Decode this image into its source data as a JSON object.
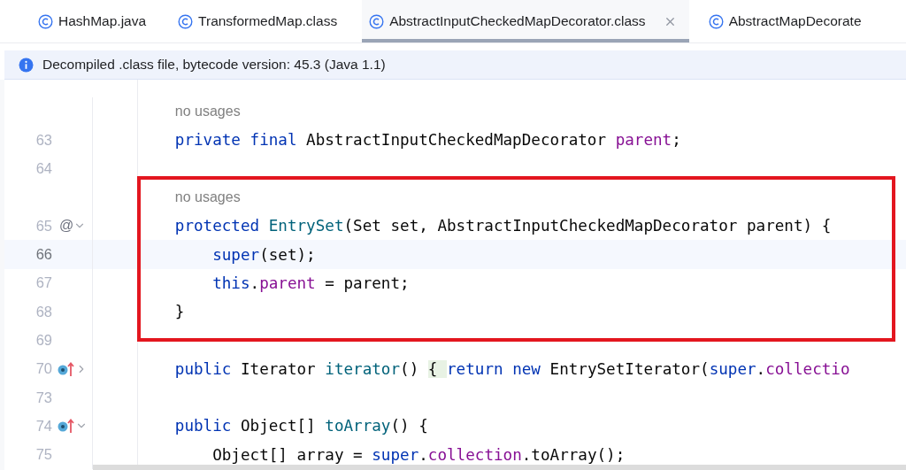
{
  "tabs": [
    {
      "label": "HashMap.java",
      "selected": false
    },
    {
      "label": "TransformedMap.class",
      "selected": false
    },
    {
      "label": "AbstractInputCheckedMapDecorator.class",
      "selected": true
    },
    {
      "label": "AbstractMapDecorate",
      "selected": false
    }
  ],
  "banner": {
    "text": "Decompiled .class file, bytecode version: 45.3 (Java 1.1)"
  },
  "editor": {
    "lines_before": [
      {
        "kind": "hint",
        "text": "no usages"
      },
      {
        "kind": "code",
        "number": "63",
        "current": false,
        "tokens": [
          {
            "kind": "keyword",
            "text": "private final"
          },
          {
            "kind": "plain",
            "text": " AbstractInputCheckedMapDecorator "
          },
          {
            "kind": "field",
            "text": "parent"
          },
          {
            "kind": "plain",
            "text": ";"
          }
        ]
      },
      {
        "kind": "code",
        "number": "64",
        "current": false
      }
    ],
    "boxed_lines": [
      {
        "kind": "hint",
        "text": "no usages"
      },
      {
        "kind": "code",
        "number": "65",
        "gutter_mark": "@",
        "expanded": true,
        "current": false,
        "tokens": [
          {
            "kind": "keyword",
            "text": "protected "
          },
          {
            "kind": "method",
            "text": "EntrySet"
          },
          {
            "kind": "plain",
            "text": "(Set set, AbstractInputCheckedMapDecorator parent) {"
          }
        ],
        "children": [
          {
            "kind": "code",
            "number": "66",
            "current": true,
            "tokens": [
              {
                "kind": "keyword",
                "text": "super"
              },
              {
                "kind": "plain",
                "text": "(set);"
              }
            ]
          },
          {
            "kind": "code",
            "number": "67",
            "current": false,
            "tokens": [
              {
                "kind": "keyword",
                "text": "this"
              },
              {
                "kind": "plain",
                "text": "."
              },
              {
                "kind": "field",
                "text": "parent"
              },
              {
                "kind": "plain",
                "text": " = parent;"
              }
            ]
          }
        ]
      },
      {
        "kind": "code",
        "number": "68",
        "current": false,
        "tokens": [
          {
            "kind": "plain",
            "text": "}"
          }
        ]
      }
    ],
    "lines_after": [
      {
        "kind": "code",
        "number": "69",
        "current": false
      },
      {
        "kind": "code",
        "number": "70",
        "override": true,
        "expanded": false,
        "current": false,
        "tokens": [
          {
            "kind": "keyword",
            "text": "public"
          },
          {
            "kind": "plain",
            "text": " Iterator "
          },
          {
            "kind": "method",
            "text": "iterator"
          },
          {
            "kind": "plain",
            "text": "() "
          },
          {
            "kind": "brace",
            "text": "{ "
          },
          {
            "kind": "keyword",
            "text": "return new"
          },
          {
            "kind": "plain",
            "text": " EntrySetIterator("
          },
          {
            "kind": "keyword",
            "text": "super"
          },
          {
            "kind": "plain",
            "text": "."
          },
          {
            "kind": "field",
            "text": "collectio"
          }
        ]
      },
      {
        "kind": "code",
        "number": "73",
        "current": false
      },
      {
        "kind": "code",
        "number": "74",
        "override": true,
        "expanded": true,
        "current": false,
        "tokens": [
          {
            "kind": "keyword",
            "text": "public"
          },
          {
            "kind": "plain",
            "text": " Object[] "
          },
          {
            "kind": "method",
            "text": "toArray"
          },
          {
            "kind": "plain",
            "text": "() {"
          }
        ],
        "children": [
          {
            "kind": "code",
            "number": "75",
            "current": false,
            "tokens": [
              {
                "kind": "plain",
                "text": "Object[] array = "
              },
              {
                "kind": "keyword",
                "text": "super"
              },
              {
                "kind": "plain",
                "text": "."
              },
              {
                "kind": "field",
                "text": "collection"
              },
              {
                "kind": "plain",
                "text": ".toArray();"
              }
            ]
          }
        ]
      }
    ]
  }
}
